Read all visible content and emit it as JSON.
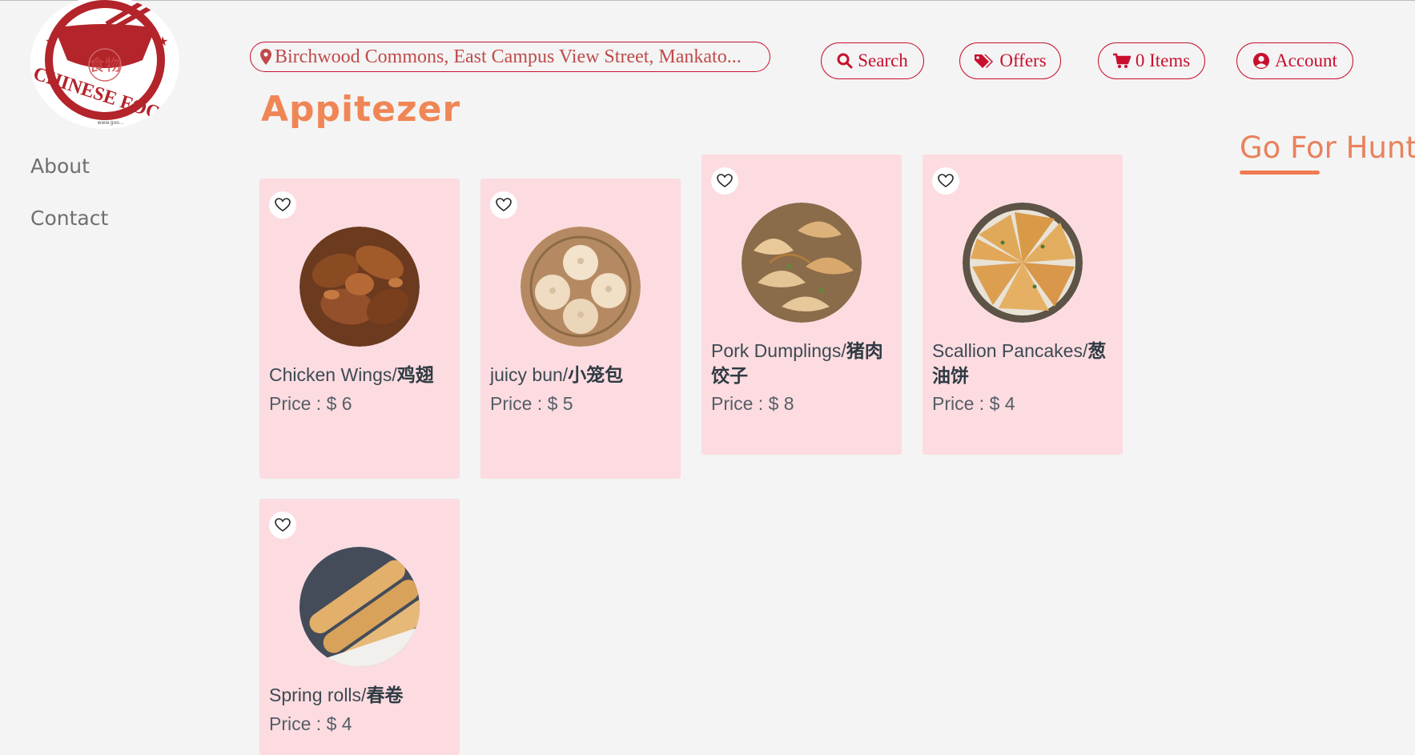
{
  "logo": {
    "top_text": "CHINESE FOOD",
    "center_text": "食物",
    "small_text": "www.goo..."
  },
  "sidebar": {
    "items": [
      {
        "label": "About"
      },
      {
        "label": "Contact"
      }
    ]
  },
  "header": {
    "location": "Birchwood Commons, East Campus View Street, Mankato...",
    "search_label": "Search",
    "offers_label": "Offers",
    "cart_label": "0 Items",
    "account_label": "Account"
  },
  "section_title": "Appitezer",
  "go_hunt": "Go For Hunt",
  "price_prefix": "Price : $ ",
  "items": [
    {
      "name_en": "Chicken Wings/",
      "name_zh": "鸡翅",
      "price": "6"
    },
    {
      "name_en": "juicy bun/",
      "name_zh": "小笼包",
      "price": "5"
    },
    {
      "name_en": "Pork Dumplings/",
      "name_zh": "猪肉饺子",
      "price": "8"
    },
    {
      "name_en": "Scallion Pancakes/",
      "name_zh": "葱油饼",
      "price": "4"
    },
    {
      "name_en": "Spring rolls/",
      "name_zh": "春卷",
      "price": "4"
    }
  ],
  "colors": {
    "brand": "#c8102e",
    "accent": "#f08656",
    "card_bg": "#fcdce1",
    "background": "#f4f4f4"
  }
}
